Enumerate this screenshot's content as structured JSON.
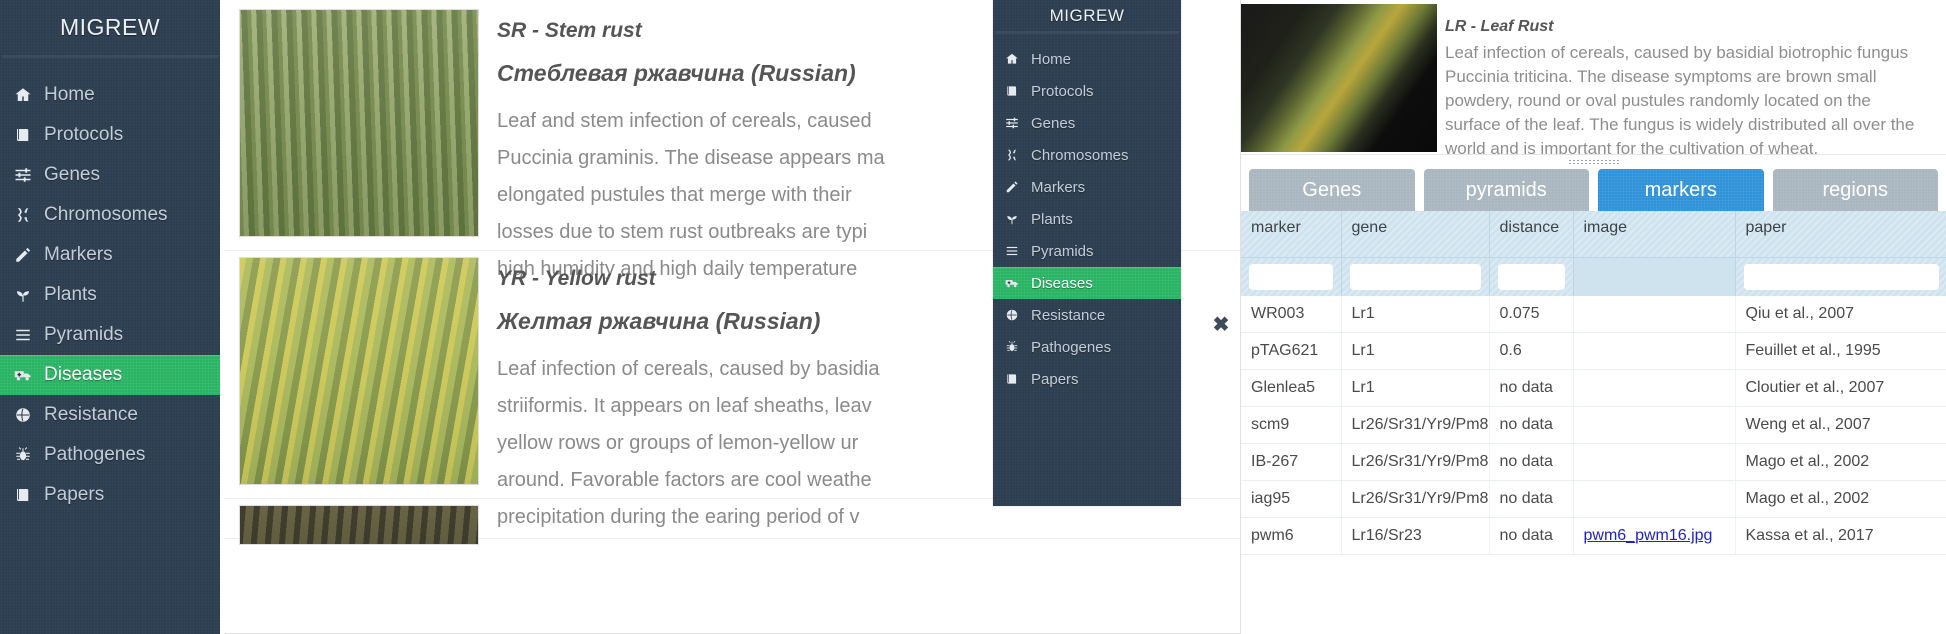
{
  "app": {
    "brand": "MIGREW"
  },
  "sidebar": {
    "items": [
      {
        "label": "Home",
        "icon": "home-icon",
        "active": false
      },
      {
        "label": "Protocols",
        "icon": "book-icon",
        "active": false
      },
      {
        "label": "Genes",
        "icon": "sliders-icon",
        "active": false
      },
      {
        "label": "Chromosomes",
        "icon": "chromosome-icon",
        "active": false
      },
      {
        "label": "Markers",
        "icon": "pencil-icon",
        "active": false
      },
      {
        "label": "Plants",
        "icon": "seedling-icon",
        "active": false
      },
      {
        "label": "Pyramids",
        "icon": "bars-icon",
        "active": false
      },
      {
        "label": "Diseases",
        "icon": "ambulance-icon",
        "active": true
      },
      {
        "label": "Resistance",
        "icon": "shield-globe-icon",
        "active": false
      },
      {
        "label": "Pathogenes",
        "icon": "bug-icon",
        "active": false
      },
      {
        "label": "Papers",
        "icon": "book-icon",
        "active": false
      }
    ]
  },
  "overlay_sidebar": {
    "brand": "MIGREW",
    "items": [
      {
        "label": "Home",
        "icon": "home-icon",
        "active": false
      },
      {
        "label": "Protocols",
        "icon": "book-icon",
        "active": false
      },
      {
        "label": "Genes",
        "icon": "sliders-icon",
        "active": false
      },
      {
        "label": "Chromosomes",
        "icon": "chromosome-icon",
        "active": false
      },
      {
        "label": "Markers",
        "icon": "pencil-icon",
        "active": false
      },
      {
        "label": "Plants",
        "icon": "seedling-icon",
        "active": false
      },
      {
        "label": "Pyramids",
        "icon": "bars-icon",
        "active": false
      },
      {
        "label": "Diseases",
        "icon": "ambulance-icon",
        "active": true
      },
      {
        "label": "Resistance",
        "icon": "shield-globe-icon",
        "active": false
      },
      {
        "label": "Pathogenes",
        "icon": "bug-icon",
        "active": false
      },
      {
        "label": "Papers",
        "icon": "book-icon",
        "active": false
      }
    ]
  },
  "close_button": {
    "glyph": "✖"
  },
  "diseases": [
    {
      "title": "SR - Stem rust",
      "subtitle": "Стеблевая ржавчина (Russian)",
      "text": "Leaf and stem infection of cereals, caused\nPuccinia graminis. The disease appears ma\nelongated pustules that merge with their \nlosses due to stem rust outbreaks are typi\nhigh humidity and high daily temperature",
      "photo_class": "photo-sr"
    },
    {
      "title": "YR - Yellow rust",
      "subtitle": "Желтая ржавчина (Russian)",
      "text": "Leaf infection of cereals, caused by basidia\nstriiformis. It appears on leaf sheaths, leav\nyellow rows or groups of lemon-yellow ur\naround. Favorable factors are cool weathe\nprecipitation during the earing period of v",
      "photo_class": "photo-yr"
    }
  ],
  "leaf_rust": {
    "title": "LR - Leaf Rust",
    "text": "Leaf infection of cereals, caused by basidial biotrophic fungus\nPuccinia triticina. The disease symptoms are brown small\npowdery, round or oval pustules randomly located on the\nsurface of the leaf. The fungus is widely distributed all over the\nworld and is important for the cultivation of wheat."
  },
  "tabs": [
    {
      "label": "Genes",
      "active": false
    },
    {
      "label": "pyramids",
      "active": false
    },
    {
      "label": "markers",
      "active": true
    },
    {
      "label": "regions",
      "active": false
    }
  ],
  "table": {
    "columns": [
      "marker",
      "gene",
      "distance",
      "image",
      "paper"
    ],
    "filters": {
      "marker": "",
      "gene": "",
      "distance": "",
      "paper": ""
    },
    "rows": [
      {
        "marker": "WR003",
        "gene": "Lr1",
        "distance": "0.075",
        "image": "",
        "paper": "Qiu et al., 2007"
      },
      {
        "marker": "pTAG621",
        "gene": "Lr1",
        "distance": "0.6",
        "image": "",
        "paper": "Feuillet et al., 1995"
      },
      {
        "marker": "Glenlea5",
        "gene": "Lr1",
        "distance": "no data",
        "image": "",
        "paper": "Cloutier et al., 2007"
      },
      {
        "marker": "scm9",
        "gene": "Lr26/Sr31/Yr9/Pm8",
        "distance": "no data",
        "image": "",
        "paper": "Weng et al., 2007"
      },
      {
        "marker": "IB-267",
        "gene": "Lr26/Sr31/Yr9/Pm8",
        "distance": "no data",
        "image": "",
        "paper": "Mago et al., 2002"
      },
      {
        "marker": "iag95",
        "gene": "Lr26/Sr31/Yr9/Pm8",
        "distance": "no data",
        "image": "",
        "paper": "Mago et al., 2002"
      },
      {
        "marker": "pwm6",
        "gene": "Lr16/Sr23",
        "distance": "no data",
        "image": "pwm6_pwm16.jpg",
        "paper": "Kassa et al., 2017"
      }
    ]
  },
  "colors": {
    "sidebar_bg": "#2d3e50",
    "active_green": "#28b463",
    "tab_active_blue": "#2e92d8",
    "tab_inactive": "#a9b6c0",
    "table_header": "#cfe3ef",
    "link_blue": "#2020cc"
  }
}
